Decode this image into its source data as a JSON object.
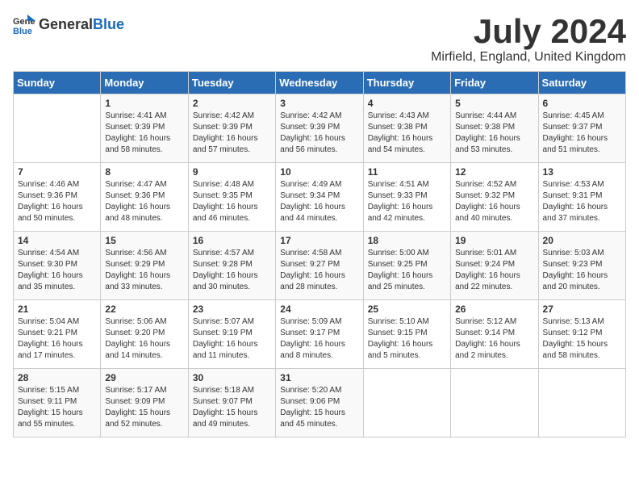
{
  "logo": {
    "general": "General",
    "blue": "Blue"
  },
  "title": "July 2024",
  "location": "Mirfield, England, United Kingdom",
  "days_of_week": [
    "Sunday",
    "Monday",
    "Tuesday",
    "Wednesday",
    "Thursday",
    "Friday",
    "Saturday"
  ],
  "weeks": [
    [
      {
        "day": "",
        "info": ""
      },
      {
        "day": "1",
        "info": "Sunrise: 4:41 AM\nSunset: 9:39 PM\nDaylight: 16 hours\nand 58 minutes."
      },
      {
        "day": "2",
        "info": "Sunrise: 4:42 AM\nSunset: 9:39 PM\nDaylight: 16 hours\nand 57 minutes."
      },
      {
        "day": "3",
        "info": "Sunrise: 4:42 AM\nSunset: 9:39 PM\nDaylight: 16 hours\nand 56 minutes."
      },
      {
        "day": "4",
        "info": "Sunrise: 4:43 AM\nSunset: 9:38 PM\nDaylight: 16 hours\nand 54 minutes."
      },
      {
        "day": "5",
        "info": "Sunrise: 4:44 AM\nSunset: 9:38 PM\nDaylight: 16 hours\nand 53 minutes."
      },
      {
        "day": "6",
        "info": "Sunrise: 4:45 AM\nSunset: 9:37 PM\nDaylight: 16 hours\nand 51 minutes."
      }
    ],
    [
      {
        "day": "7",
        "info": "Sunrise: 4:46 AM\nSunset: 9:36 PM\nDaylight: 16 hours\nand 50 minutes."
      },
      {
        "day": "8",
        "info": "Sunrise: 4:47 AM\nSunset: 9:36 PM\nDaylight: 16 hours\nand 48 minutes."
      },
      {
        "day": "9",
        "info": "Sunrise: 4:48 AM\nSunset: 9:35 PM\nDaylight: 16 hours\nand 46 minutes."
      },
      {
        "day": "10",
        "info": "Sunrise: 4:49 AM\nSunset: 9:34 PM\nDaylight: 16 hours\nand 44 minutes."
      },
      {
        "day": "11",
        "info": "Sunrise: 4:51 AM\nSunset: 9:33 PM\nDaylight: 16 hours\nand 42 minutes."
      },
      {
        "day": "12",
        "info": "Sunrise: 4:52 AM\nSunset: 9:32 PM\nDaylight: 16 hours\nand 40 minutes."
      },
      {
        "day": "13",
        "info": "Sunrise: 4:53 AM\nSunset: 9:31 PM\nDaylight: 16 hours\nand 37 minutes."
      }
    ],
    [
      {
        "day": "14",
        "info": "Sunrise: 4:54 AM\nSunset: 9:30 PM\nDaylight: 16 hours\nand 35 minutes."
      },
      {
        "day": "15",
        "info": "Sunrise: 4:56 AM\nSunset: 9:29 PM\nDaylight: 16 hours\nand 33 minutes."
      },
      {
        "day": "16",
        "info": "Sunrise: 4:57 AM\nSunset: 9:28 PM\nDaylight: 16 hours\nand 30 minutes."
      },
      {
        "day": "17",
        "info": "Sunrise: 4:58 AM\nSunset: 9:27 PM\nDaylight: 16 hours\nand 28 minutes."
      },
      {
        "day": "18",
        "info": "Sunrise: 5:00 AM\nSunset: 9:25 PM\nDaylight: 16 hours\nand 25 minutes."
      },
      {
        "day": "19",
        "info": "Sunrise: 5:01 AM\nSunset: 9:24 PM\nDaylight: 16 hours\nand 22 minutes."
      },
      {
        "day": "20",
        "info": "Sunrise: 5:03 AM\nSunset: 9:23 PM\nDaylight: 16 hours\nand 20 minutes."
      }
    ],
    [
      {
        "day": "21",
        "info": "Sunrise: 5:04 AM\nSunset: 9:21 PM\nDaylight: 16 hours\nand 17 minutes."
      },
      {
        "day": "22",
        "info": "Sunrise: 5:06 AM\nSunset: 9:20 PM\nDaylight: 16 hours\nand 14 minutes."
      },
      {
        "day": "23",
        "info": "Sunrise: 5:07 AM\nSunset: 9:19 PM\nDaylight: 16 hours\nand 11 minutes."
      },
      {
        "day": "24",
        "info": "Sunrise: 5:09 AM\nSunset: 9:17 PM\nDaylight: 16 hours\nand 8 minutes."
      },
      {
        "day": "25",
        "info": "Sunrise: 5:10 AM\nSunset: 9:15 PM\nDaylight: 16 hours\nand 5 minutes."
      },
      {
        "day": "26",
        "info": "Sunrise: 5:12 AM\nSunset: 9:14 PM\nDaylight: 16 hours\nand 2 minutes."
      },
      {
        "day": "27",
        "info": "Sunrise: 5:13 AM\nSunset: 9:12 PM\nDaylight: 15 hours\nand 58 minutes."
      }
    ],
    [
      {
        "day": "28",
        "info": "Sunrise: 5:15 AM\nSunset: 9:11 PM\nDaylight: 15 hours\nand 55 minutes."
      },
      {
        "day": "29",
        "info": "Sunrise: 5:17 AM\nSunset: 9:09 PM\nDaylight: 15 hours\nand 52 minutes."
      },
      {
        "day": "30",
        "info": "Sunrise: 5:18 AM\nSunset: 9:07 PM\nDaylight: 15 hours\nand 49 minutes."
      },
      {
        "day": "31",
        "info": "Sunrise: 5:20 AM\nSunset: 9:06 PM\nDaylight: 15 hours\nand 45 minutes."
      },
      {
        "day": "",
        "info": ""
      },
      {
        "day": "",
        "info": ""
      },
      {
        "day": "",
        "info": ""
      }
    ]
  ]
}
